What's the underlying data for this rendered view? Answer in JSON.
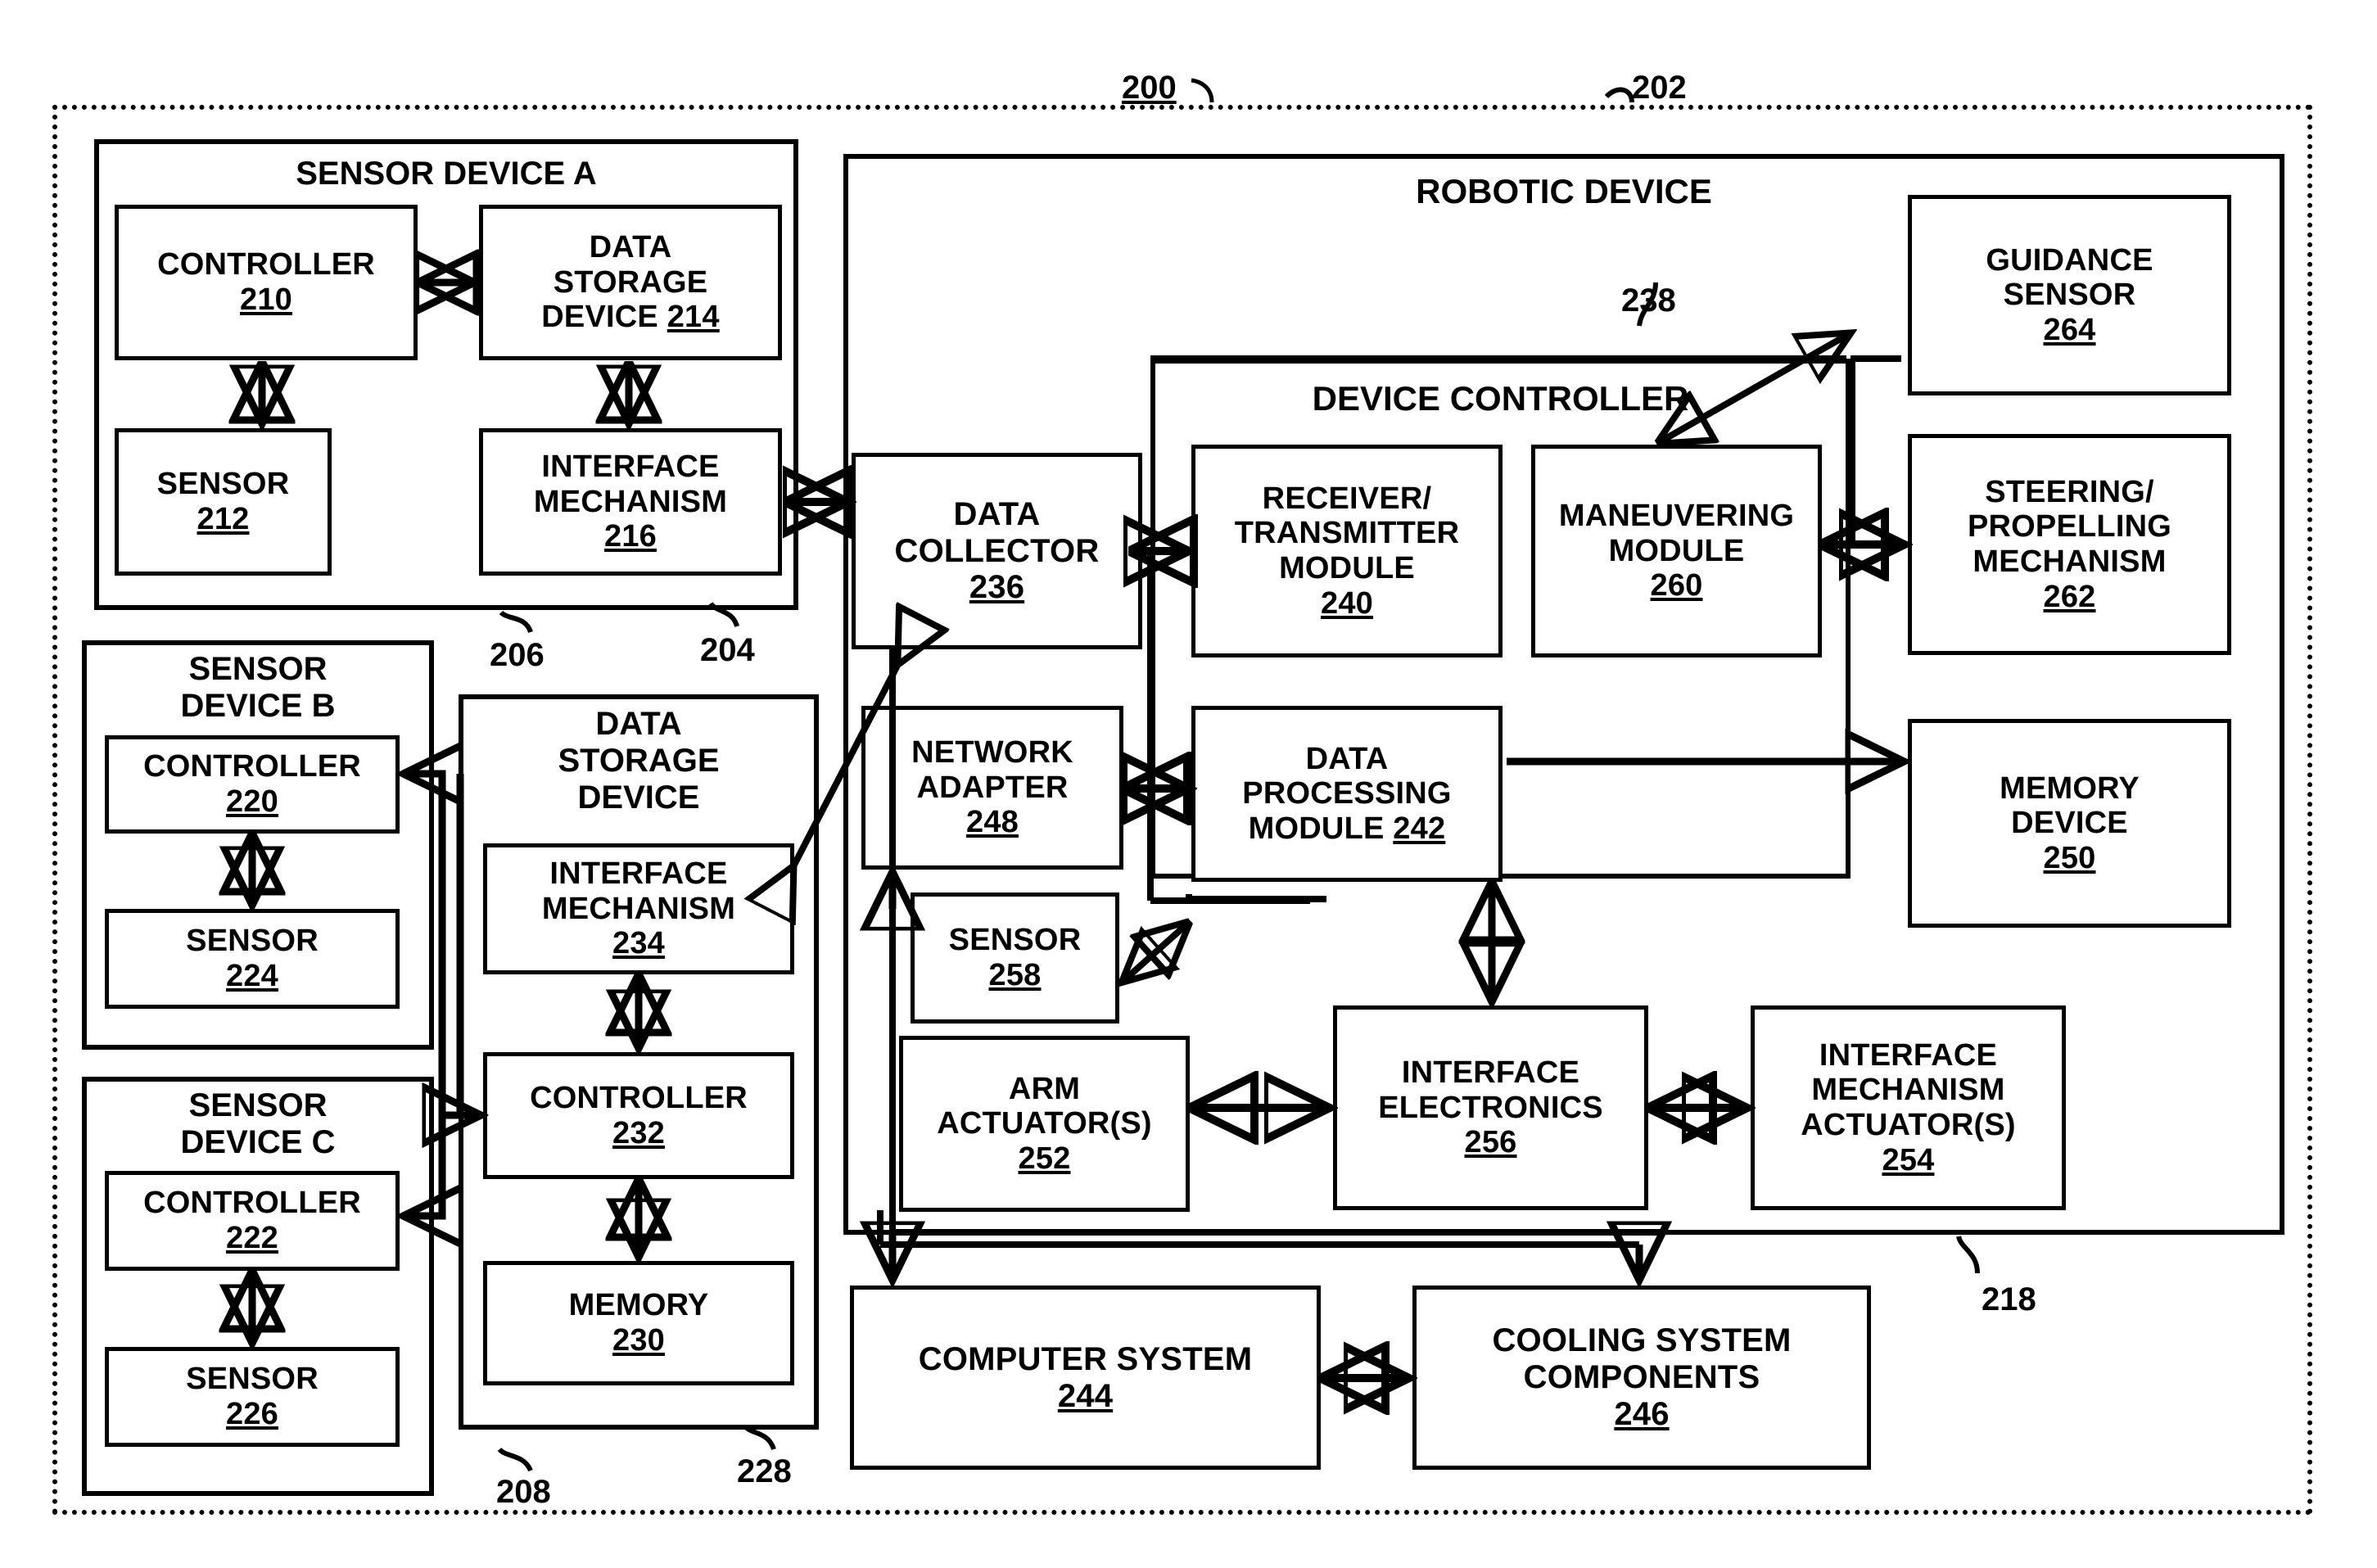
{
  "figure": {
    "system_ref": "200",
    "robotic_device_ref": "202",
    "sensor_device_a_ref": "204",
    "sensor_device_b_ref": "206",
    "sensor_device_c_ref": "208",
    "robot_body_ref": "218",
    "data_storage_device_ref": "228",
    "device_controller_ref": "238"
  },
  "sensor_device_a": {
    "title": "SENSOR DEVICE A",
    "controller": {
      "label": "CONTROLLER",
      "ref": "210"
    },
    "data_storage_device": {
      "label_line1": "DATA",
      "label_line2": "STORAGE",
      "label_line3": "DEVICE",
      "ref": "214"
    },
    "sensor": {
      "label": "SENSOR",
      "ref": "212"
    },
    "interface_mechanism": {
      "label_line1": "INTERFACE",
      "label_line2": "MECHANISM",
      "ref": "216"
    }
  },
  "sensor_device_b": {
    "title_line1": "SENSOR",
    "title_line2": "DEVICE B",
    "controller": {
      "label": "CONTROLLER",
      "ref": "220"
    },
    "sensor": {
      "label": "SENSOR",
      "ref": "224"
    }
  },
  "sensor_device_c": {
    "title_line1": "SENSOR",
    "title_line2": "DEVICE C",
    "controller": {
      "label": "CONTROLLER",
      "ref": "222"
    },
    "sensor": {
      "label": "SENSOR",
      "ref": "226"
    }
  },
  "data_storage_device": {
    "title_line1": "DATA",
    "title_line2": "STORAGE",
    "title_line3": "DEVICE",
    "interface_mechanism": {
      "label_line1": "INTERFACE",
      "label_line2": "MECHANISM",
      "ref": "234"
    },
    "controller": {
      "label": "CONTROLLER",
      "ref": "232"
    },
    "memory": {
      "label": "MEMORY",
      "ref": "230"
    }
  },
  "robotic_device": {
    "title": "ROBOTIC DEVICE",
    "device_controller": {
      "title": "DEVICE CONTROLLER",
      "receiver_transmitter_module": {
        "label_line1": "RECEIVER/",
        "label_line2": "TRANSMITTER",
        "label_line3": "MODULE",
        "ref": "240"
      },
      "maneuvering_module": {
        "label_line1": "MANEUVERING",
        "label_line2": "MODULE",
        "ref": "260"
      },
      "data_processing_module": {
        "label_line1": "DATA",
        "label_line2": "PROCESSING",
        "label_line3": "MODULE",
        "ref": "242"
      }
    },
    "data_collector": {
      "label_line1": "DATA",
      "label_line2": "COLLECTOR",
      "ref": "236"
    },
    "network_adapter": {
      "label_line1": "NETWORK",
      "label_line2": "ADAPTER",
      "ref": "248"
    },
    "sensor": {
      "label": "SENSOR",
      "ref": "258"
    },
    "arm_actuators": {
      "label_line1": "ARM",
      "label_line2": "ACTUATOR(S)",
      "ref": "252"
    },
    "interface_electronics": {
      "label_line1": "INTERFACE",
      "label_line2": "ELECTRONICS",
      "ref": "256"
    },
    "interface_mechanism_actuators": {
      "label_line1": "INTERFACE",
      "label_line2": "MECHANISM",
      "label_line3": "ACTUATOR(S)",
      "ref": "254"
    },
    "guidance_sensor": {
      "label_line1": "GUIDANCE",
      "label_line2": "SENSOR",
      "ref": "264"
    },
    "steering_propelling_mechanism": {
      "label_line1": "STEERING/",
      "label_line2": "PROPELLING",
      "label_line3": "MECHANISM",
      "ref": "262"
    },
    "memory_device": {
      "label_line1": "MEMORY",
      "label_line2": "DEVICE",
      "ref": "250"
    },
    "computer_system": {
      "label": "COMPUTER SYSTEM",
      "ref": "244"
    },
    "cooling_system_components": {
      "label_line1": "COOLING SYSTEM",
      "label_line2": "COMPONENTS",
      "ref": "246"
    }
  },
  "colors": {
    "line": "#000000",
    "background": "#ffffff"
  }
}
